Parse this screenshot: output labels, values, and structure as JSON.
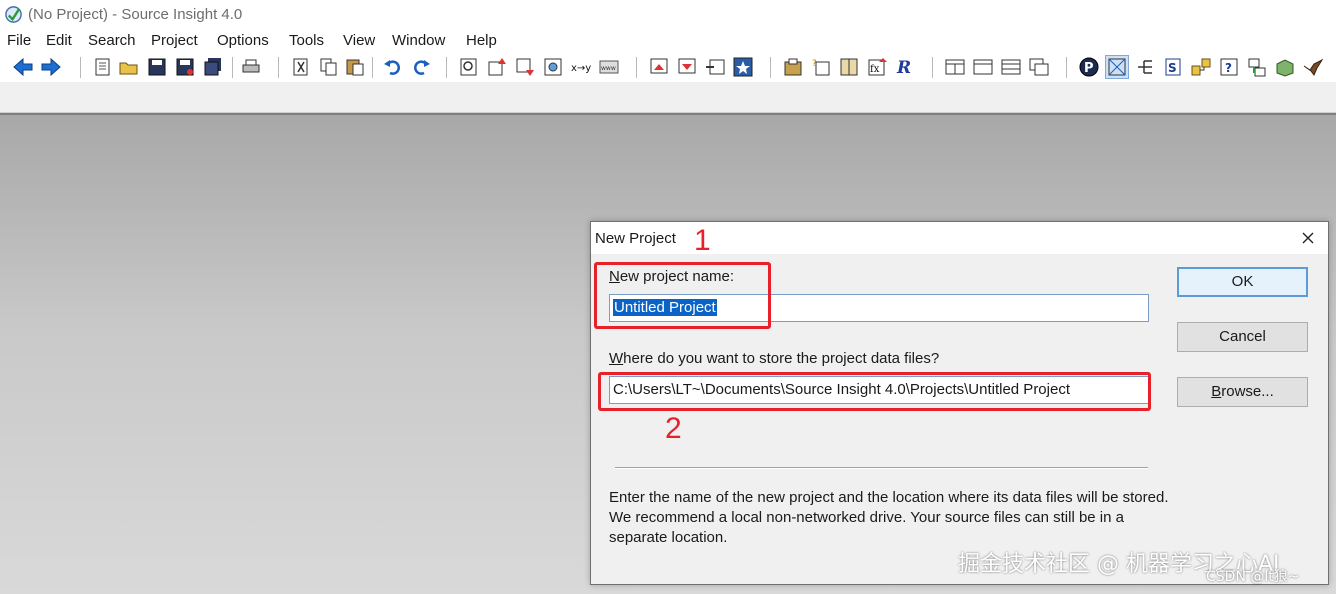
{
  "window": {
    "title": "(No Project) - Source Insight 4.0"
  },
  "menu": [
    "File",
    "Edit",
    "Search",
    "Project",
    "Options",
    "Tools",
    "View",
    "Window",
    "Help"
  ],
  "toolbar_icons": [
    "back-arrow-icon",
    "forward-arrow-icon",
    "new-file-icon",
    "open-folder-icon",
    "save-icon",
    "save-as-icon",
    "save-all-icon",
    "print-icon",
    "cut-icon",
    "copy-icon",
    "paste-icon",
    "undo-icon",
    "redo-icon",
    "search-files-icon",
    "jump-up-icon",
    "jump-down-icon",
    "browse-icon",
    "replace-icon",
    "web-icon",
    "bookmark-prev-icon",
    "bookmark-next-icon",
    "symbol-window-icon",
    "star-icon",
    "project-icon",
    "symbol-info-icon",
    "book-icon",
    "function-icon",
    "relation-icon",
    "layout-1-icon",
    "layout-2-icon",
    "layout-3-icon",
    "layout-4-icon",
    "parse-icon",
    "context-icon",
    "tree-icon",
    "source-icon",
    "folder-tree-icon",
    "help-icon",
    "call-graph-icon",
    "package-icon",
    "bird-icon"
  ],
  "dialog": {
    "title": "New Project",
    "name_label": "New project name:",
    "name_value": "Untitled Project",
    "location_label": "Where do you want to store the project data files?",
    "location_value": "C:\\Users\\LT~\\Documents\\Source Insight 4.0\\Projects\\Untitled Project",
    "ok_label": "OK",
    "cancel_label": "Cancel",
    "browse_label": "Browse...",
    "description": "Enter the name of the new project and the location where its data files will be stored. We recommend a local non-networked drive. Your source files can still be in a separate location."
  },
  "annotations": {
    "first": "1",
    "second": "2"
  },
  "watermark": {
    "main": "掘金技术社区 @ 机器学习之心AI",
    "sub": "CSDN @lt狼~"
  },
  "colors": {
    "annotation_red": "#e8202a",
    "selection_blue": "#0a64c8",
    "focus_border": "#5d9ad8"
  }
}
